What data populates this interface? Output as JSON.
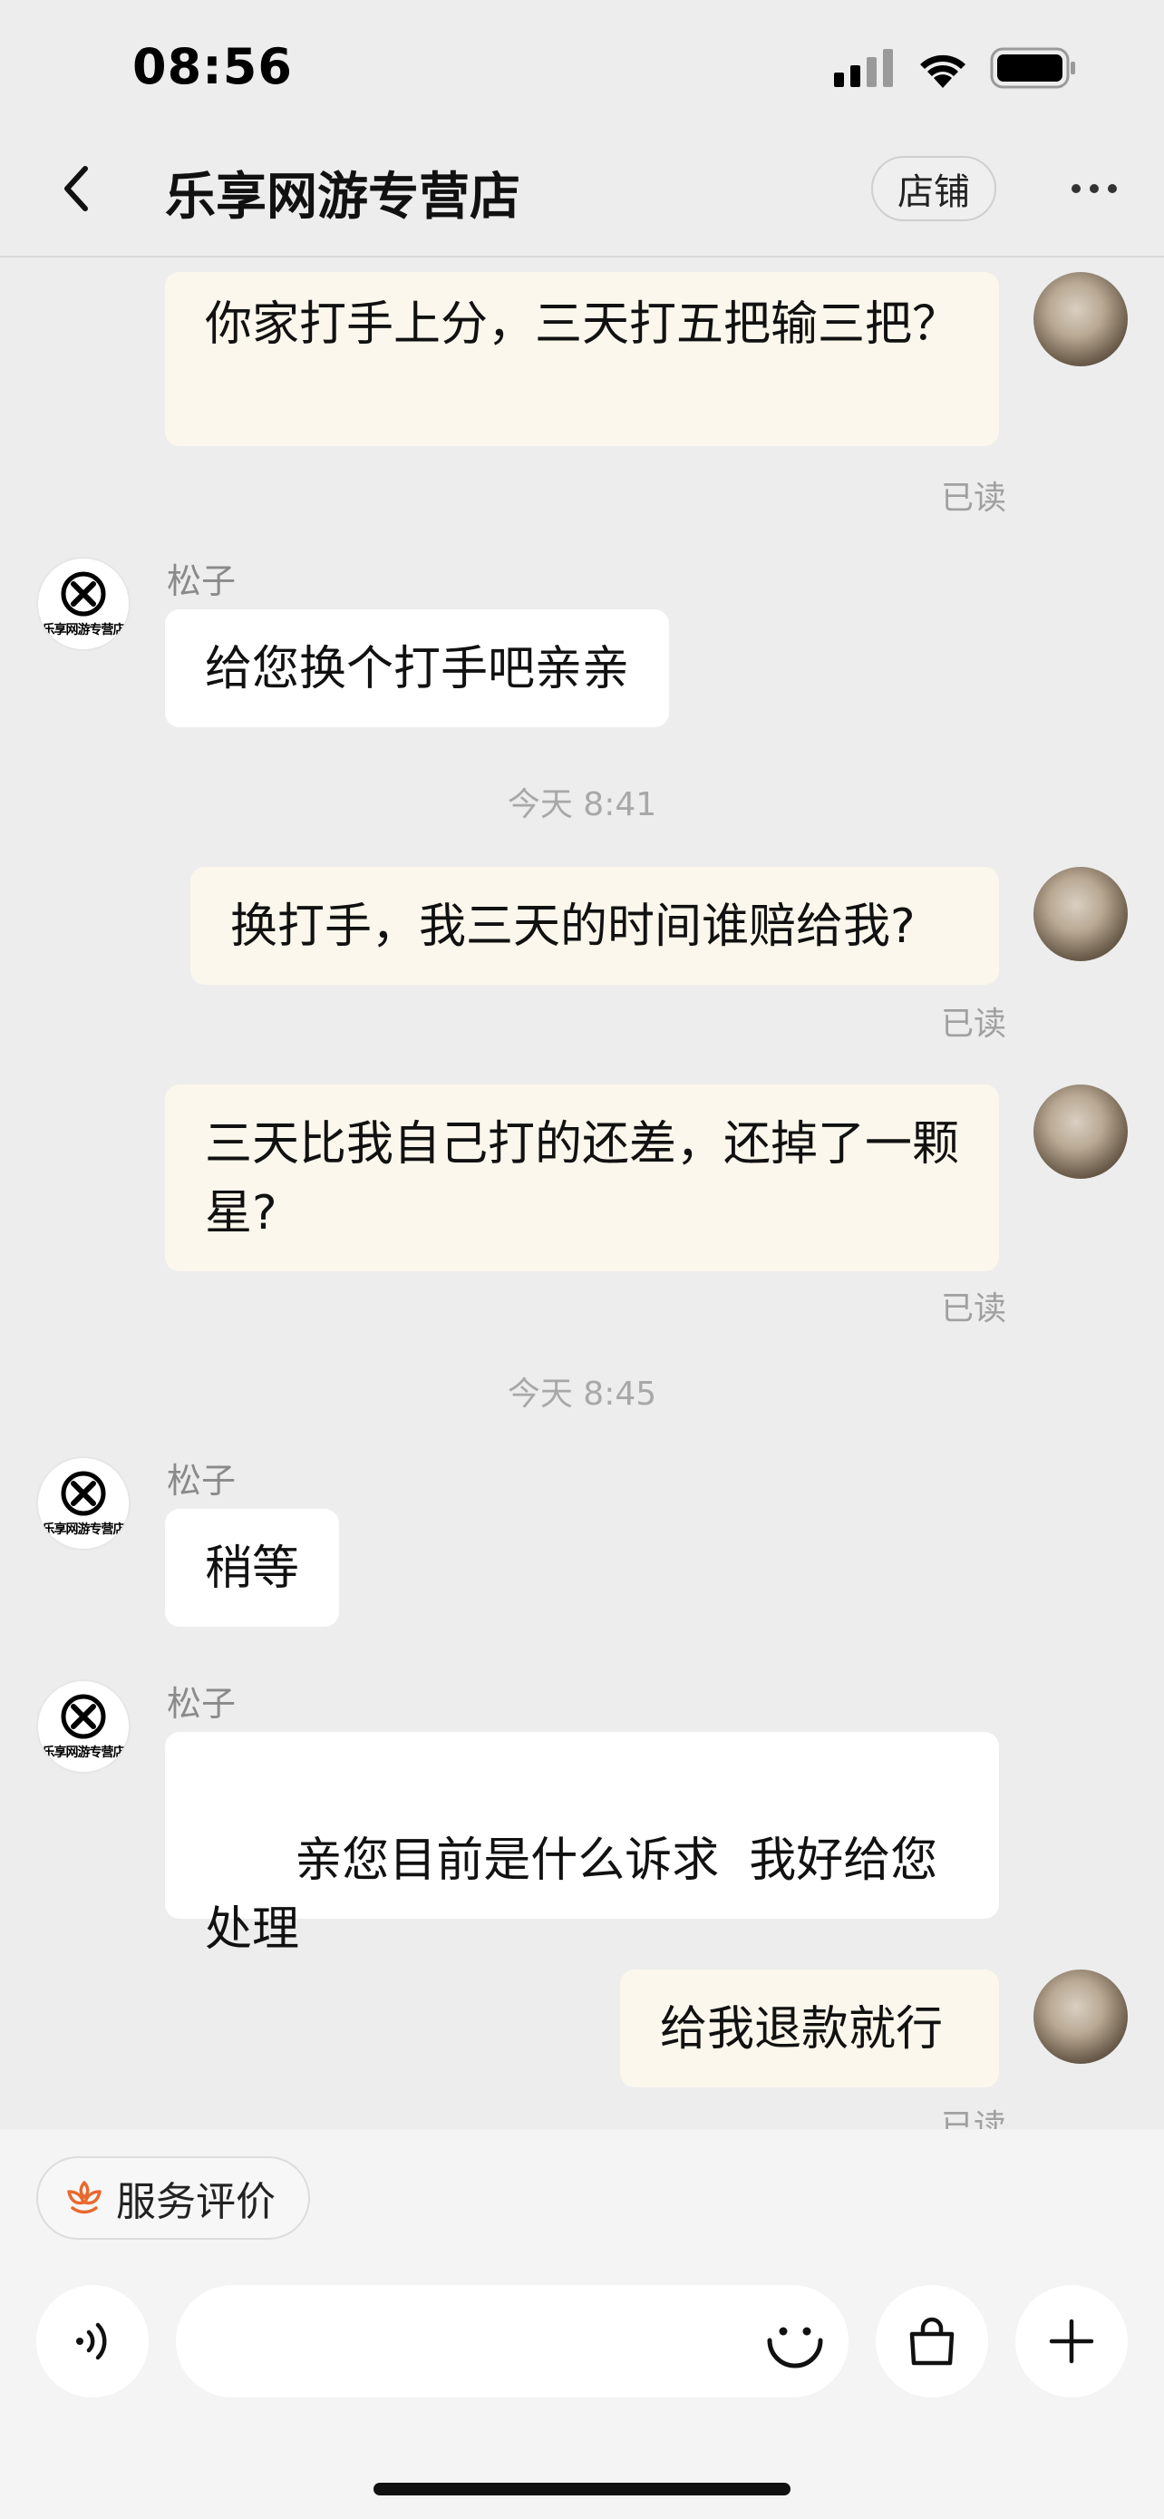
{
  "status_bar": {
    "time": "08:56"
  },
  "nav": {
    "title": "乐享网游专营店",
    "shop_button": "店铺"
  },
  "shop_logo_text": "乐享网游专营店",
  "messages": {
    "m1": {
      "text": "你家打手上分，三天打五把输三把？",
      "read": "已读"
    },
    "m2": {
      "sender": "松子",
      "text": "给您换个打手吧亲亲"
    },
    "t1": "今天 8:41",
    "m3": {
      "text": "换打手，我三天的时间谁赔给我?",
      "read": "已读"
    },
    "m4": {
      "text": "三天比我自己打的还差，还掉了一颗星?",
      "read": "已读"
    },
    "t2": "今天 8:45",
    "m5": {
      "sender": "松子",
      "text": "稍等"
    },
    "m6": {
      "sender": "松子",
      "text": "亲您目前是什么诉求  我好给您处理"
    },
    "m7": {
      "text": "给我退款就行",
      "read": "已读"
    }
  },
  "bottom": {
    "rating_label": "服务评价",
    "input_placeholder": ""
  },
  "colors": {
    "outgoing_bubble": "#fcf7ec",
    "incoming_bubble": "#ffffff",
    "rating_icon": "#e8692e",
    "background": "#ededed"
  }
}
